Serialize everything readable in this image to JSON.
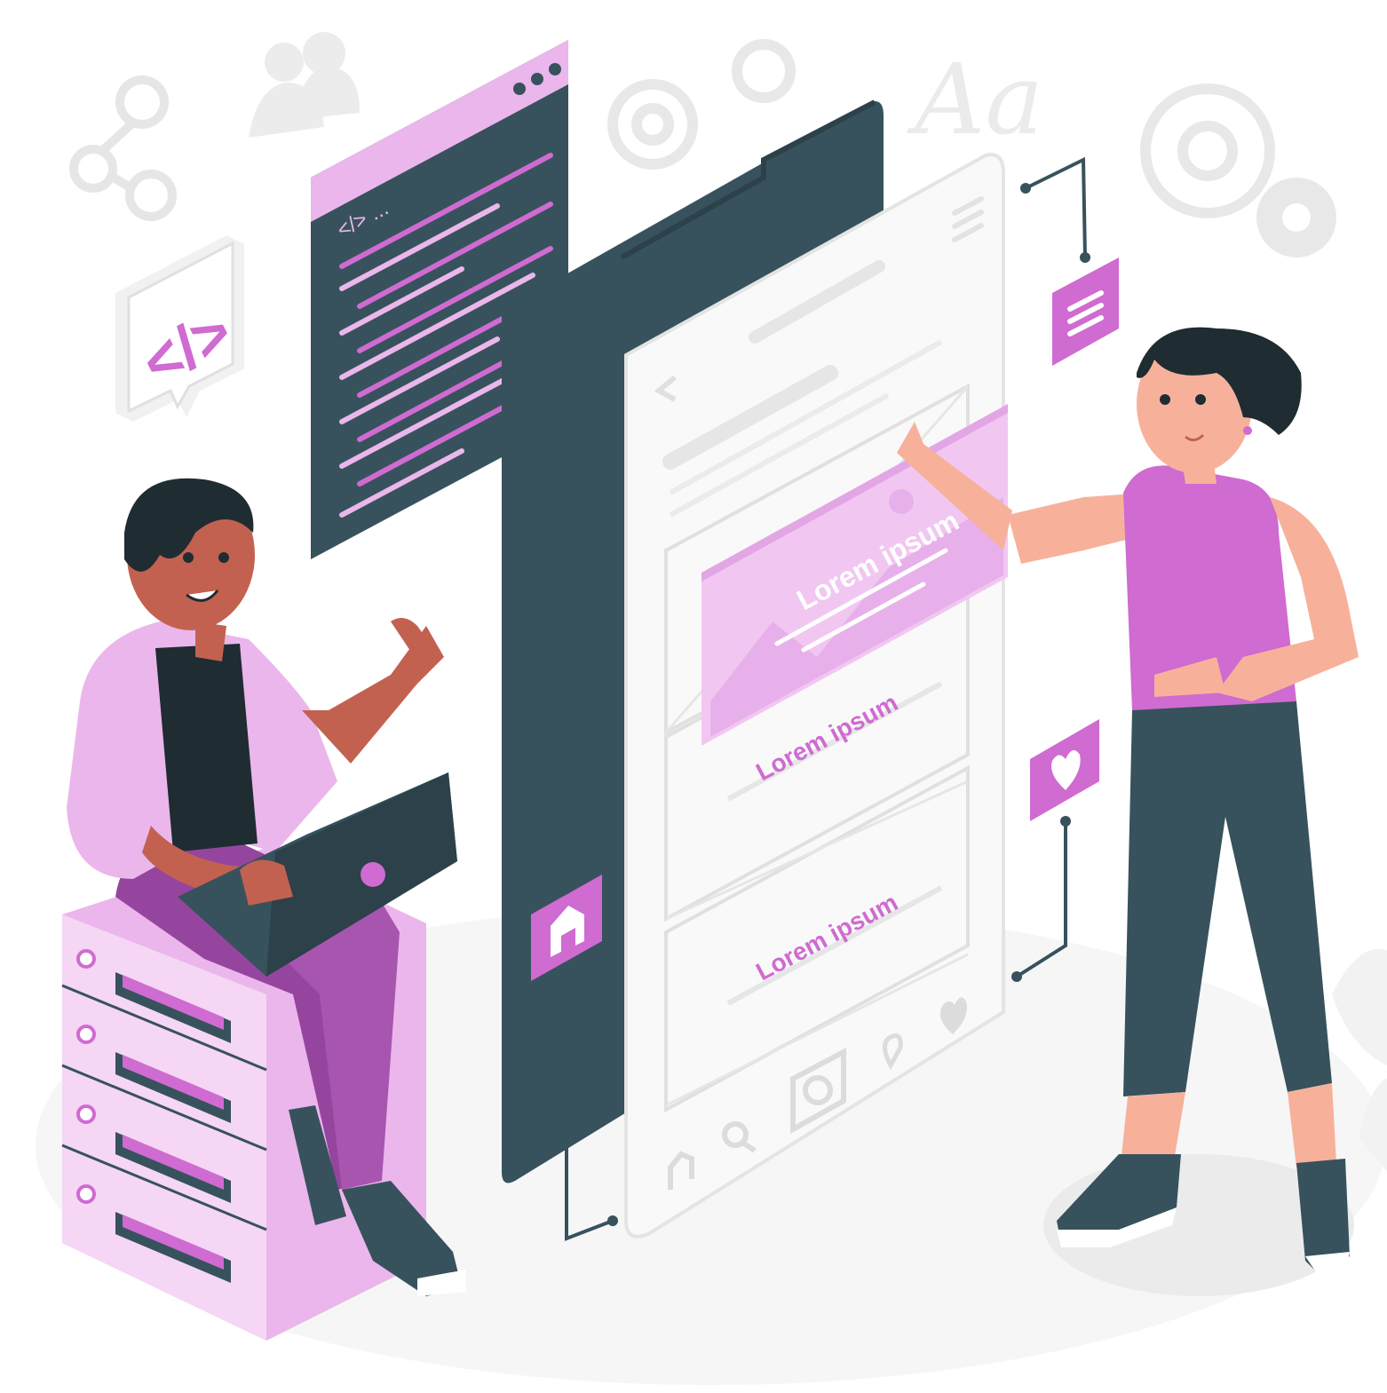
{
  "illustration": {
    "card_overlay_text": "Lorem ipsum",
    "list_item_1_text": "Lorem ipsum",
    "list_item_2_text": "Lorem ipsum",
    "code_tag_text": "</>",
    "code_window_tag": "</> ...",
    "font_sample_text": "Aa"
  },
  "colors": {
    "accent": "#cf6bd1",
    "accent_light": "#ebb6ec",
    "accent_pale": "#f5d6f5",
    "dark": "#37525c",
    "outline": "#e4e4e4",
    "skin_dark": "#c36150",
    "skin_light": "#f7b19b"
  },
  "icons": [
    "share-icon",
    "users-icon",
    "code-icon",
    "gear-icon",
    "font-icon",
    "menu-lines-icon",
    "heart-icon",
    "home-icon",
    "search-icon",
    "camera-icon",
    "location-pin-icon",
    "back-arrow-icon"
  ]
}
